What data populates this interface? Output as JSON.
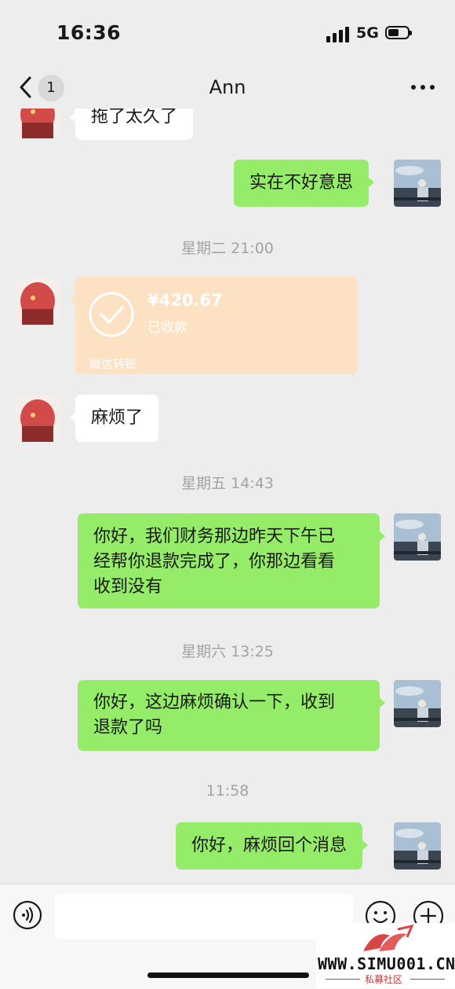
{
  "status_bar": {
    "time": "16:36",
    "network": "5G"
  },
  "nav": {
    "unread_count": "1",
    "title": "Ann",
    "icons": [
      "back-icon",
      "more-icon"
    ]
  },
  "messages": [
    {
      "side": "left",
      "text": "拖了太久了"
    },
    {
      "side": "right",
      "text": "实在不好意思"
    },
    {
      "timestamp": "星期二 21:00"
    },
    {
      "side": "left",
      "type": "transfer",
      "amount": "¥420.67",
      "status": "已收款",
      "footer": "微信转账"
    },
    {
      "side": "left",
      "text": "麻烦了"
    },
    {
      "timestamp": "星期五 14:43"
    },
    {
      "side": "right",
      "lines": [
        "你好，我们财务那边昨天下午已",
        "经帮你退款完成了，你那边看看",
        "收到没有"
      ]
    },
    {
      "timestamp": "星期六 13:25"
    },
    {
      "side": "right",
      "lines": [
        "你好，这边麻烦确认一下，收到",
        "退款了吗"
      ]
    },
    {
      "timestamp": "11:58"
    },
    {
      "side": "right",
      "text": "你好，麻烦回个消息"
    }
  ],
  "input_bar": {
    "icons": [
      "voice-icon",
      "emoji-icon",
      "plus-icon"
    ]
  },
  "watermark": {
    "site": "WWW.SIMU001.CN",
    "caption": "私募社区"
  },
  "colors": {
    "background": "#ededed",
    "sent_bubble": "#95ec69",
    "received_bubble": "#ffffff",
    "transfer_card": "#fde1c3"
  }
}
